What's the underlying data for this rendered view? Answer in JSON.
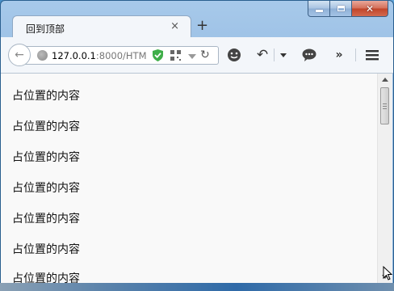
{
  "window": {
    "minimize_icon": "minimize-icon",
    "maximize_icon": "maximize-icon",
    "close_icon": "close-icon",
    "close_glyph": "✕"
  },
  "tab": {
    "title": "回到顶部",
    "close_glyph": "×",
    "new_tab_glyph": "+"
  },
  "toolbar": {
    "back_glyph": "←",
    "url_host": "127.0.0.1",
    "url_rest": ":8000/HTM",
    "reload_glyph": "↻",
    "undo_glyph": "↶",
    "more_glyph": "»"
  },
  "content": {
    "lines": [
      "占位置的内容",
      "占位置的内容",
      "占位置的内容",
      "占位置的内容",
      "占位置的内容",
      "占位置的内容",
      "占位置的内容"
    ]
  },
  "colors": {
    "window_frame": "#a7c9ea",
    "close_button": "#c1452a",
    "content_bg": "#f9f9f9"
  }
}
